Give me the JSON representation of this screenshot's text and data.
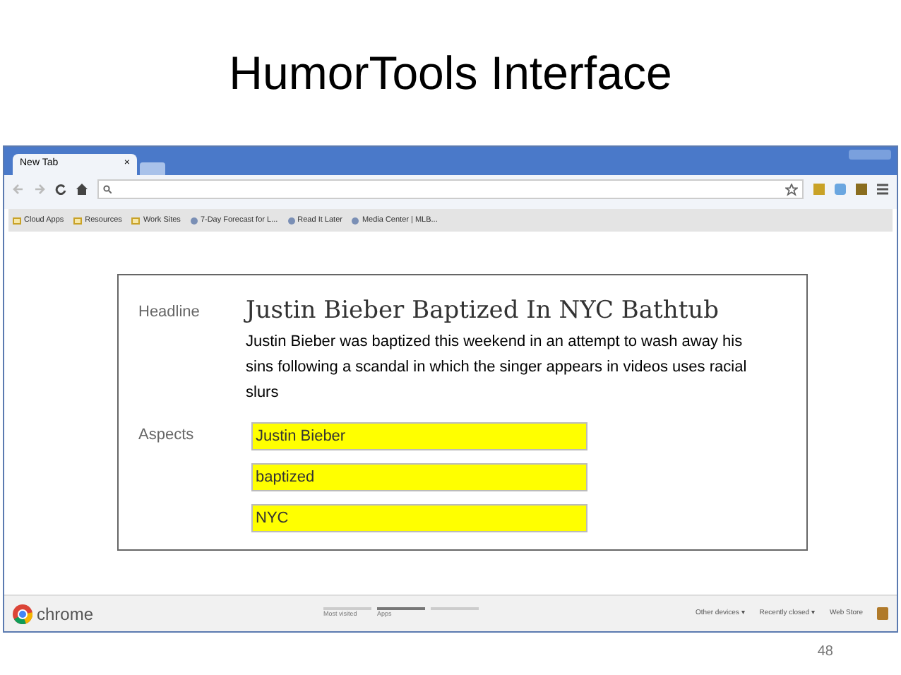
{
  "slide": {
    "title": "HumorTools Interface",
    "page_number": "48"
  },
  "browser": {
    "tabs": [
      {
        "label": "New Tab",
        "close": "×",
        "selected": true
      }
    ],
    "bookmarks": [
      {
        "label": "Cloud Apps",
        "kind": "folder"
      },
      {
        "label": "Resources",
        "kind": "folder"
      },
      {
        "label": "Work Sites",
        "kind": "folder"
      },
      {
        "label": "7-Day Forecast for L...",
        "kind": "page"
      },
      {
        "label": "Read It Later",
        "kind": "page"
      },
      {
        "label": "Media Center | MLB...",
        "kind": "page"
      }
    ],
    "footer": {
      "brand": "chrome",
      "pages": [
        {
          "label": "Most visited",
          "selected": false
        },
        {
          "label": "Apps",
          "selected": true
        },
        {
          "selected": false
        }
      ],
      "links": [
        "Other devices ▾",
        "Recently closed ▾",
        "Web Store"
      ]
    }
  },
  "card": {
    "headline_label": "Headline",
    "headline": "Justin Bieber Baptized In NYC Bathtub",
    "summary": "Justin Bieber was baptized this weekend in an attempt to wash away his sins following a scandal in which the singer appears in videos uses racial slurs",
    "aspects_label": "Aspects",
    "aspects": [
      "Justin Bieber",
      "baptized",
      "NYC"
    ]
  }
}
